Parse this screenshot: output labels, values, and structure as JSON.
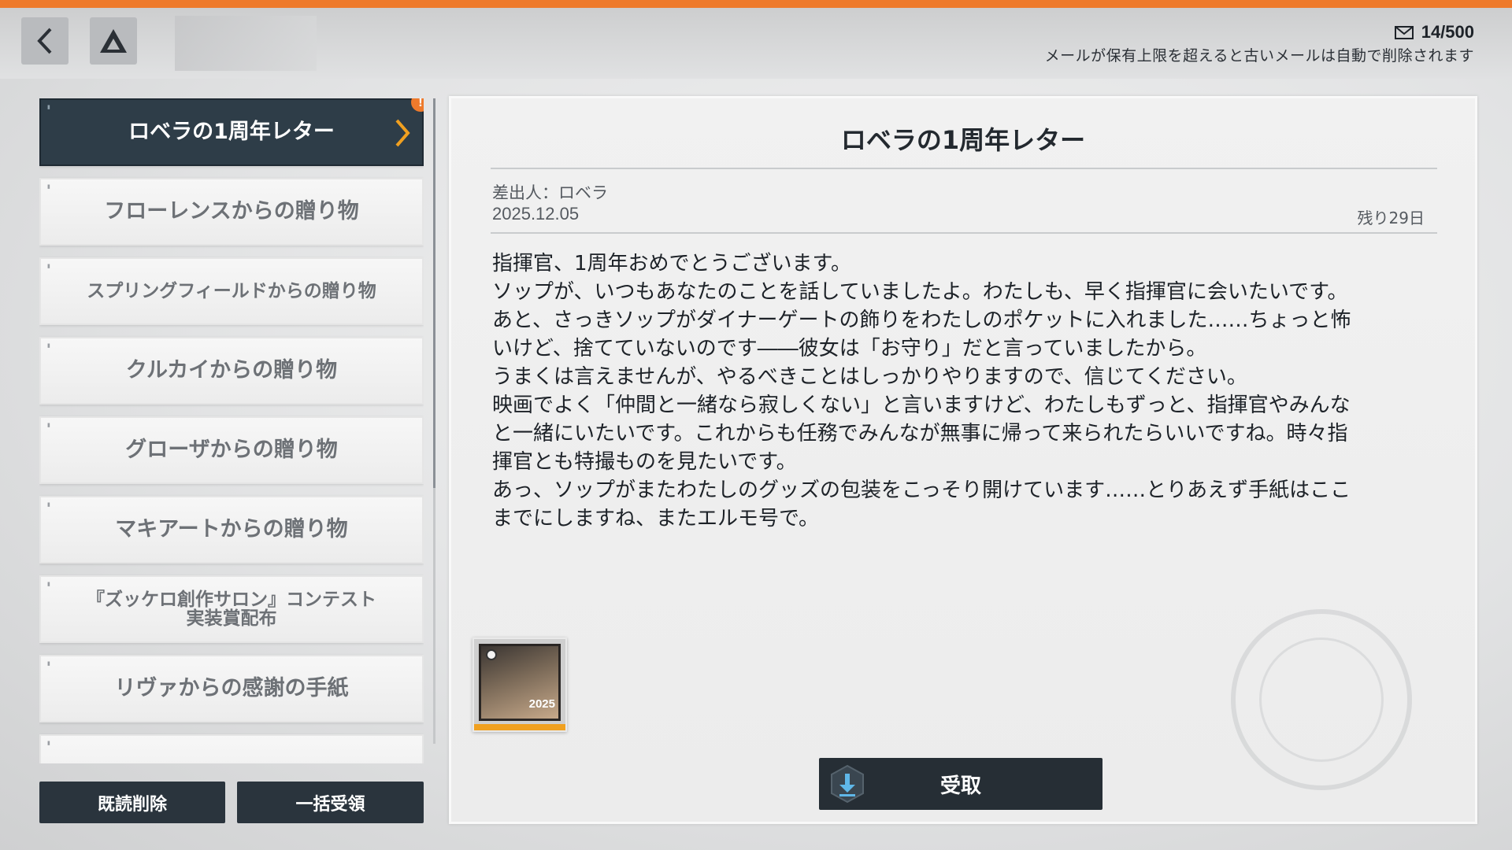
{
  "header": {
    "mail_count": "14/500",
    "mail_notice": "メールが保有上限を超えると古いメールは自動で削除されます"
  },
  "sidebar": {
    "items": [
      {
        "label": "ロベラの1周年レター",
        "active": true
      },
      {
        "label": "フローレンスからの贈り物"
      },
      {
        "label": "スプリングフィールドからの贈り物"
      },
      {
        "label": "クルカイからの贈り物"
      },
      {
        "label": "グローザからの贈り物"
      },
      {
        "label": "マキアートからの贈り物"
      },
      {
        "label_line1": "『ズッケロ創作サロン』コンテスト",
        "label_line2": "実装賞配布"
      },
      {
        "label": "リヴァからの感謝の手紙"
      }
    ],
    "delete_read_label": "既読削除",
    "claim_all_label": "一括受領"
  },
  "detail": {
    "title": "ロベラの1周年レター",
    "sender": "差出人：ロベラ",
    "date": "2025.12.05",
    "remaining": "残り29日",
    "body": [
      "指揮官、1周年おめでとうございます。",
      "ソップが、いつもあなたのことを話していましたよ。わたしも、早く指揮官に会いたいです。",
      "あと、さっきソップがダイナーゲートの飾りをわたしのポケットに入れました……ちょっと怖",
      "いけど、捨てていないのです――彼女は「お守り」だと言っていましたから。",
      "うまくは言えませんが、やるべきことはしっかりやりますので、信じてください。",
      "映画でよく「仲間と一緒なら寂しくない」と言いますけど、わたしもずっと、指揮官やみんな",
      "と一緒にいたいです。これからも任務でみんなが無事に帰って来られたらいいですね。時々指",
      "揮官とも特撮ものを見たいです。",
      "あっ、ソップがまたわたしのグッズの包装をこっそり開けています……とりあえず手紙はここ",
      "までにしますね、またエルモ号で。"
    ],
    "reward_year": "2025",
    "claim_label": "受取"
  },
  "colors": {
    "accent": "#ee7a2c",
    "active_item": "#2e3d48",
    "button_dark": "#2a343d"
  }
}
